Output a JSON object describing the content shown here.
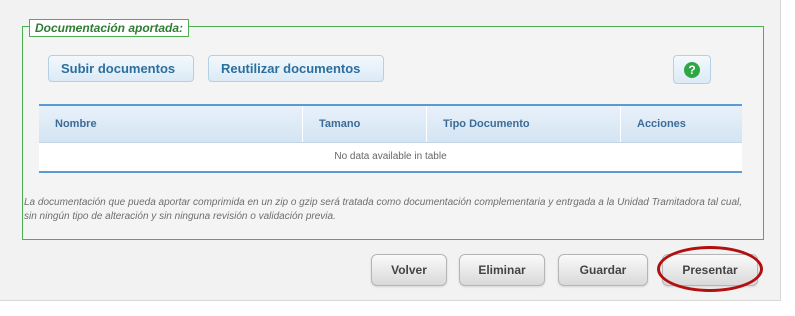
{
  "section": {
    "legend": "Documentación aportada:"
  },
  "toolbar": {
    "upload_label": "Subir documentos",
    "reuse_label": "Reutilizar documentos",
    "help_label": "?"
  },
  "table": {
    "columns": [
      "Nombre",
      "Tamano",
      "Tipo Documento",
      "Acciones"
    ],
    "empty_message": "No data available in table"
  },
  "note": "La documentación que pueda aportar comprimida en un zip o gzip será tratada como documentación complementaria y entrgada a la Unidad Tramitadora tal cual, sin ningún tipo de alteración y sin ninguna revisión o validación previa.",
  "actions": {
    "back_label": "Volver",
    "delete_label": "Eliminar",
    "save_label": "Guardar",
    "submit_label": "Presentar"
  },
  "colors": {
    "fieldset_border": "#4caf50",
    "table_accent": "#5a9bd5",
    "highlight": "#b01010",
    "help_icon": "#2ea643"
  }
}
